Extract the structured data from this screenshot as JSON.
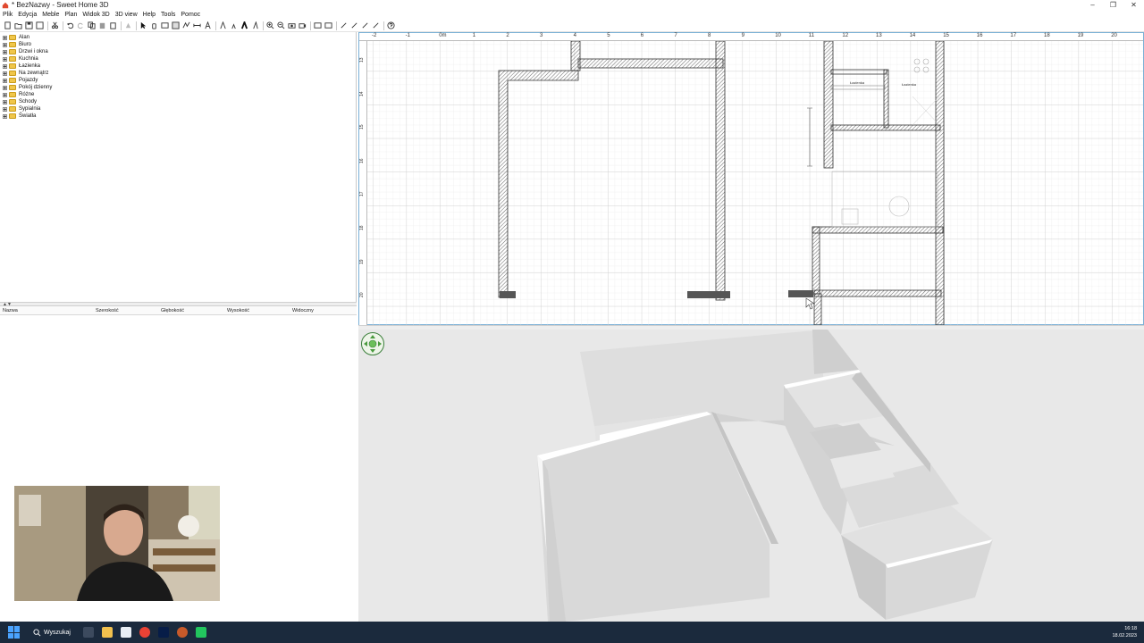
{
  "window": {
    "title": "* BezNazwy - Sweet Home 3D",
    "controls": {
      "minimize": "–",
      "maximize": "❐",
      "close": "✕"
    }
  },
  "menu": [
    "Plik",
    "Edycja",
    "Meble",
    "Plan",
    "Widok 3D",
    "3D view",
    "Help",
    "Tools",
    "Pomoc"
  ],
  "catalog": [
    "Alan",
    "Biuro",
    "Drzwi i okna",
    "Kuchnia",
    "Łazienka",
    "Na zewnątrz",
    "Pojazdy",
    "Pokój dzienny",
    "Różne",
    "Schody",
    "Sypialnia",
    "Światła"
  ],
  "furniture_table": {
    "columns": [
      "Nazwa",
      "Szerokość",
      "Głębokość",
      "Wysokość",
      "Widoczny"
    ]
  },
  "plan": {
    "ruler_top": [
      "-2",
      "-1",
      "0m",
      "1",
      "2",
      "3",
      "4",
      "5",
      "6",
      "7",
      "8",
      "9",
      "10",
      "11",
      "12",
      "13",
      "14",
      "15",
      "16",
      "17",
      "18",
      "19",
      "20"
    ],
    "ruler_left": [
      "13",
      "14",
      "15",
      "16",
      "17",
      "18",
      "19",
      "20"
    ],
    "room_labels": [
      "Łazienka",
      "Łazienka"
    ]
  },
  "taskbar": {
    "search_label": "Wyszukaj",
    "time": "16:18",
    "date": "18.02.2023"
  },
  "colors": {
    "wall_fill": "#555555",
    "grid": "#d8d8d8",
    "accent": "#7ab0d6",
    "taskbar": "#1b2a3d"
  }
}
